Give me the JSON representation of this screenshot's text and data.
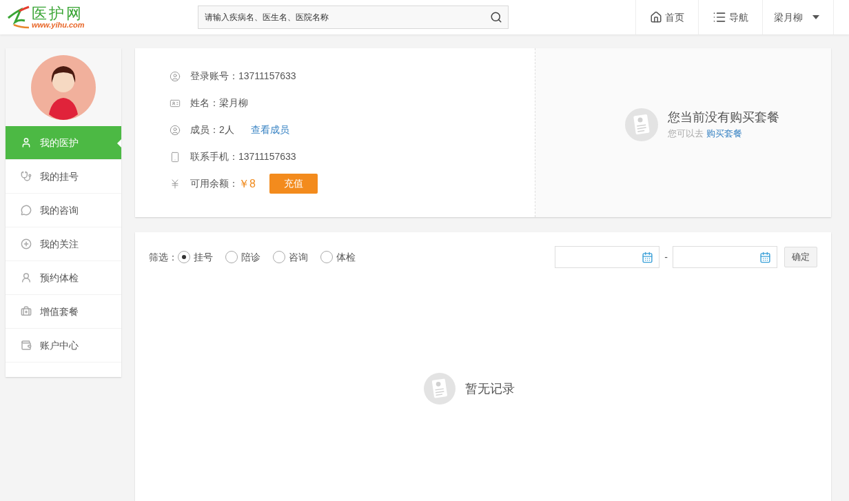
{
  "header": {
    "logo": {
      "name": "医护网",
      "url": "www.yihu.com"
    },
    "search": {
      "placeholder": "请输入疾病名、医生名、医院名称"
    },
    "nav": [
      {
        "label": "首页",
        "kind": "home"
      },
      {
        "label": "导航",
        "kind": "list"
      },
      {
        "label": "梁月柳",
        "kind": "user"
      }
    ]
  },
  "sidebar": {
    "items": [
      {
        "label": "我的医护",
        "selected": true
      },
      {
        "label": "我的挂号",
        "selected": false
      },
      {
        "label": "我的咨询",
        "selected": false
      },
      {
        "label": "我的关注",
        "selected": false
      },
      {
        "label": "预约体检",
        "selected": false
      },
      {
        "label": "增值套餐",
        "selected": false
      },
      {
        "label": "账户中心",
        "selected": false
      }
    ]
  },
  "profile": {
    "rows": [
      {
        "kind": "text",
        "label": "登录账号：",
        "value": "13711157633"
      },
      {
        "kind": "text",
        "label": "姓名：",
        "value": "梁月柳"
      },
      {
        "kind": "link",
        "label": "成员：",
        "value": "2人",
        "link": "查看成员"
      },
      {
        "kind": "text",
        "label": "联系手机：",
        "value": "13711157633"
      },
      {
        "kind": "balance",
        "label": "可用余额：",
        "value": "￥8",
        "button": "充值"
      }
    ]
  },
  "package": {
    "title": "您当前没有购买套餐",
    "hint": "您可以去",
    "link": "购买套餐"
  },
  "filter": {
    "label": "筛选：",
    "options": [
      {
        "label": "挂号",
        "selected": true
      },
      {
        "label": "陪诊",
        "selected": false
      },
      {
        "label": "咨询",
        "selected": false
      },
      {
        "label": "体检",
        "selected": false
      }
    ],
    "separator": "-",
    "confirm": "确定",
    "empty": "暂无记录"
  }
}
